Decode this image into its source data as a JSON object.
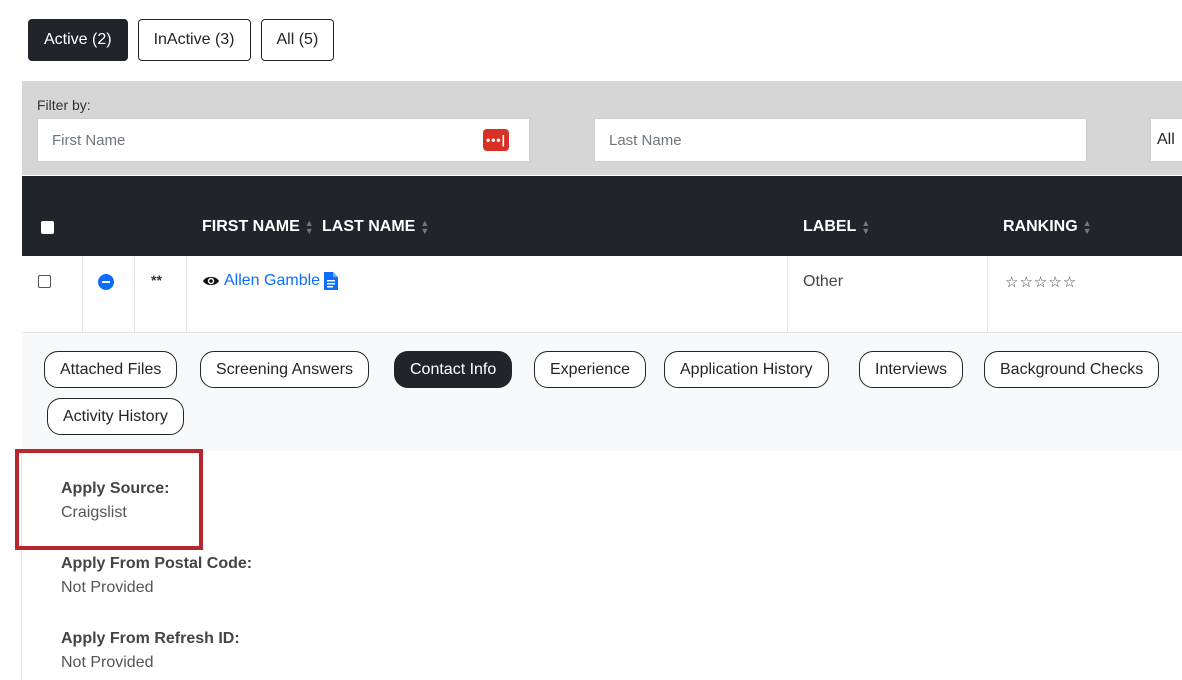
{
  "status_tabs": [
    {
      "label": "Active (2)",
      "active": true
    },
    {
      "label": "InActive (3)",
      "active": false
    },
    {
      "label": "All (5)",
      "active": false
    }
  ],
  "filter": {
    "label": "Filter by:",
    "first_name_placeholder": "First Name",
    "last_name_placeholder": "Last Name",
    "status_select": "All",
    "password_icon_glyph": "•••|"
  },
  "table": {
    "headers": {
      "name": "FIRST NAME",
      "last_name": "LAST NAME",
      "label": "LABEL",
      "ranking": "RANKING"
    },
    "row": {
      "flag": "**",
      "name": "Allen Gamble",
      "label": "Other",
      "ranking_stars": "☆☆☆☆☆"
    }
  },
  "detail_tabs": [
    {
      "label": "Attached Files",
      "active": false
    },
    {
      "label": "Screening Answers",
      "active": false
    },
    {
      "label": "Contact Info",
      "active": true
    },
    {
      "label": "Experience",
      "active": false
    },
    {
      "label": "Application History",
      "active": false
    },
    {
      "label": "Interviews",
      "active": false
    },
    {
      "label": "Background Checks",
      "active": false
    },
    {
      "label": "Activity History",
      "active": false
    }
  ],
  "contact_info": [
    {
      "title": "Apply Source:",
      "value": "Craigslist"
    },
    {
      "title": "Apply From Postal Code:",
      "value": "Not Provided"
    },
    {
      "title": "Apply From Refresh ID:",
      "value": "Not Provided"
    }
  ],
  "colors": {
    "dark": "#212529",
    "link": "#0d6efd",
    "highlight": "#b8262d",
    "password_manager": "#d93025"
  }
}
